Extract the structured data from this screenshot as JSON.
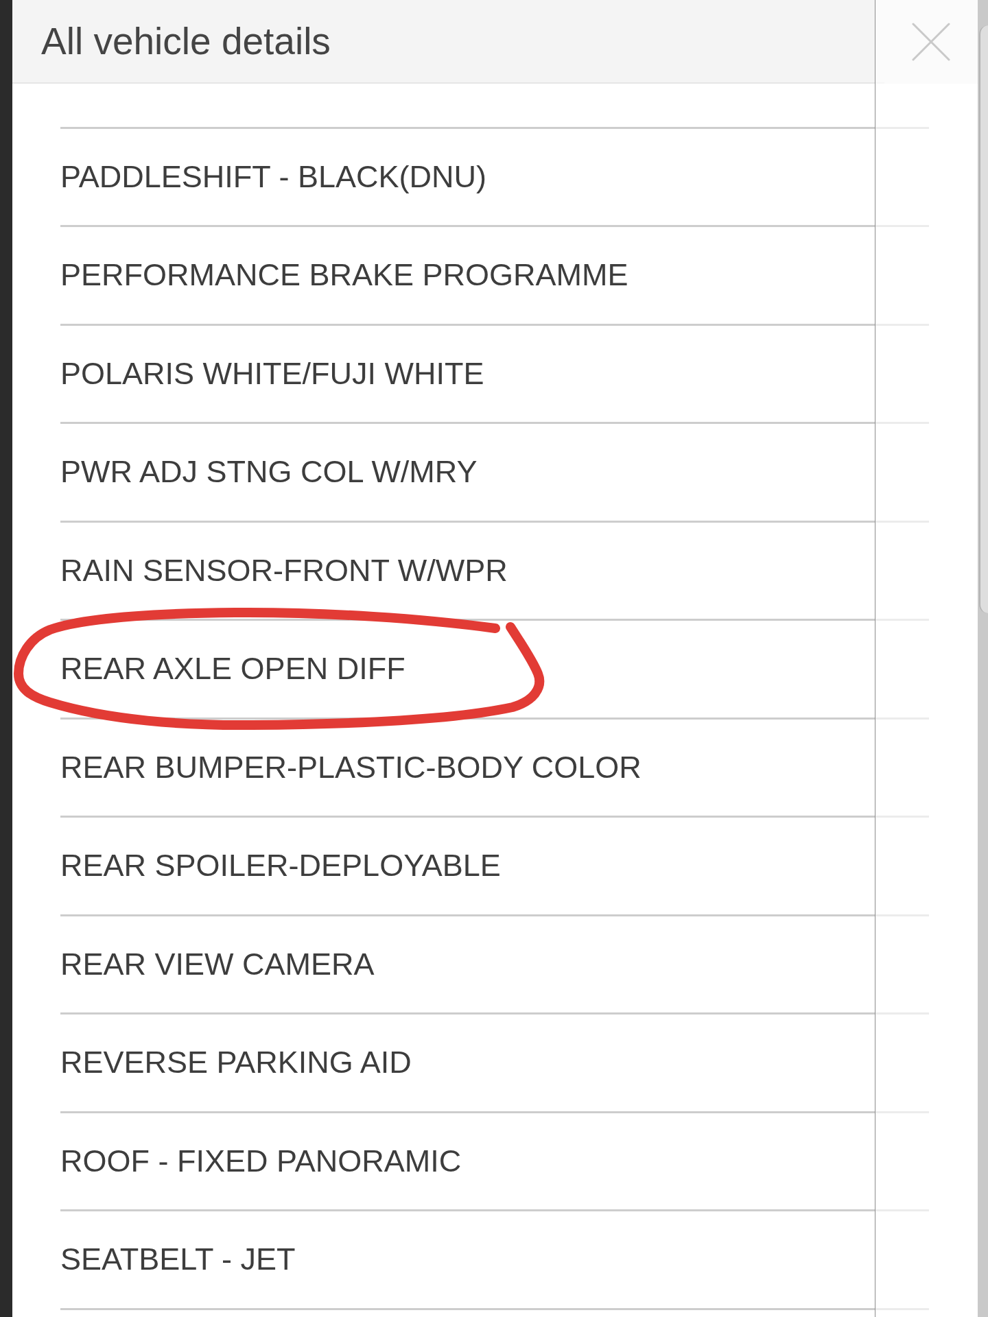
{
  "dialog": {
    "title": "All vehicle details"
  },
  "items": [
    {
      "label": "PADDLESHIFT - BLACK(DNU)",
      "circled": false
    },
    {
      "label": "PERFORMANCE BRAKE PROGRAMME",
      "circled": false
    },
    {
      "label": "POLARIS WHITE/FUJI WHITE",
      "circled": false
    },
    {
      "label": "PWR ADJ STNG COL W/MRY",
      "circled": false
    },
    {
      "label": "RAIN SENSOR-FRONT W/WPR",
      "circled": false
    },
    {
      "label": "REAR AXLE OPEN DIFF",
      "circled": true
    },
    {
      "label": "REAR BUMPER-PLASTIC-BODY COLOR",
      "circled": false
    },
    {
      "label": "REAR SPOILER-DEPLOYABLE",
      "circled": false
    },
    {
      "label": "REAR VIEW CAMERA",
      "circled": false
    },
    {
      "label": "REVERSE PARKING AID",
      "circled": false
    },
    {
      "label": "ROOF - FIXED PANORAMIC",
      "circled": false
    },
    {
      "label": "SEATBELT - JET",
      "circled": false
    }
  ]
}
